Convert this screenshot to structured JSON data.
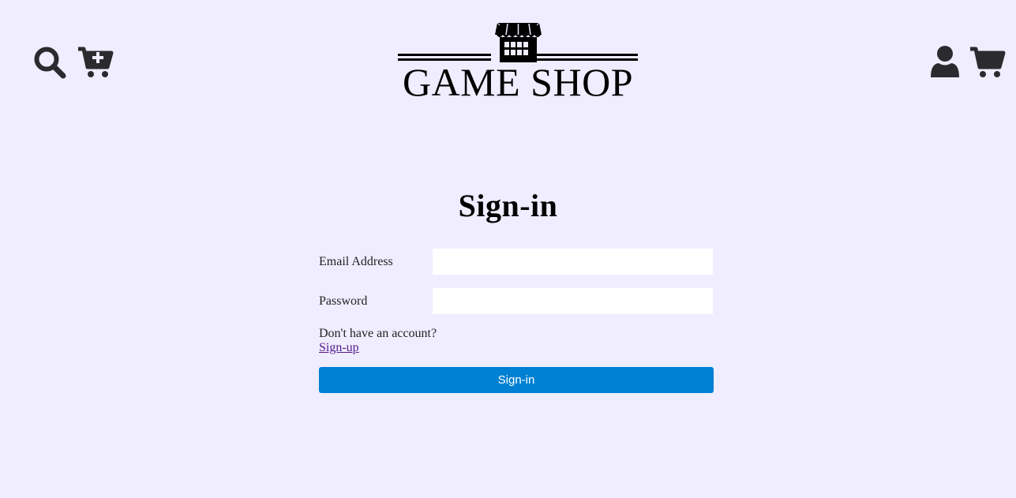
{
  "header": {
    "left_icons": [
      "search-icon",
      "add-to-cart-icon"
    ],
    "right_icons": [
      "user-icon",
      "cart-icon"
    ],
    "logo": {
      "icon": "storefront-icon",
      "text": "GAME SHOP"
    }
  },
  "form": {
    "title": "Sign-in",
    "email_label": "Email Address",
    "email_value": "",
    "password_label": "Password",
    "password_value": "",
    "account_prompt": "Don't have an account?",
    "signup_link": "Sign-up",
    "submit_label": "Sign-in"
  },
  "colors": {
    "background": "#efedff",
    "button": "#0080d3",
    "link": "#551a8b",
    "icon": "#2b2b2f"
  }
}
